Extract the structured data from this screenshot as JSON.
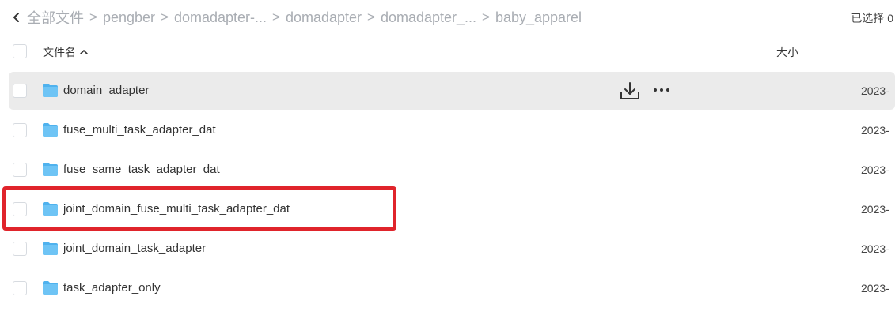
{
  "breadcrumb": {
    "items": [
      "全部文件",
      "pengber",
      "domadapter-...",
      "domadapter",
      "domadapter_...",
      "baby_apparel"
    ],
    "separator": ">"
  },
  "selection": {
    "label": "已选择 0"
  },
  "table": {
    "columns": {
      "name": "文件名",
      "size": "大小"
    },
    "sort_indicator": "ascending",
    "rows": [
      {
        "name": "domain_adapter",
        "date": "2023-",
        "hovered": true
      },
      {
        "name": "fuse_multi_task_adapter_dat",
        "date": "2023-"
      },
      {
        "name": "fuse_same_task_adapter_dat",
        "date": "2023-"
      },
      {
        "name": "joint_domain_fuse_multi_task_adapter_dat",
        "date": "2023-",
        "highlighted": true
      },
      {
        "name": "joint_domain_task_adapter",
        "date": "2023-"
      },
      {
        "name": "task_adapter_only",
        "date": "2023-"
      }
    ]
  },
  "colors": {
    "folder": "#6ec4f5",
    "folder_dark": "#4fb2ee",
    "highlight": "#e0242b",
    "hover_bg": "#ebebeb",
    "breadcrumb": "#a9adb3"
  },
  "icons": {
    "back": "chevron-left-icon",
    "sort": "chevron-up-icon",
    "folder": "folder-icon",
    "download": "download-icon",
    "more": "more-horizontal-icon"
  }
}
